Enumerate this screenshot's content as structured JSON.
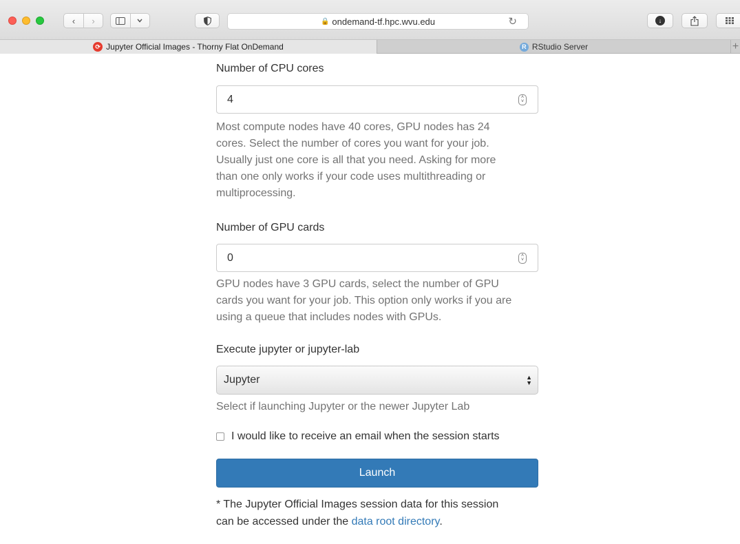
{
  "browser": {
    "url": "ondemand-tf.hpc.wvu.edu",
    "nav_back": "‹",
    "nav_forward": "›",
    "tabs": [
      {
        "title": "Jupyter Official Images - Thorny Flat OnDemand",
        "active": true,
        "favicon": "jupyter-icon"
      },
      {
        "title": "RStudio Server",
        "active": false,
        "favicon": "r-icon"
      }
    ],
    "new_tab_label": "+"
  },
  "form": {
    "cpu": {
      "label": "Number of CPU cores",
      "value": "4",
      "help_lines": [
        "Most compute nodes have 40 cores, GPU nodes has 24",
        "cores. Select the number of cores you want for your job.",
        "Usually just one core is all that you need. Asking for more",
        "than one only works if your code uses multithreading or",
        "multiprocessing."
      ]
    },
    "gpu": {
      "label": "Number of GPU cards",
      "value": "0",
      "help_lines": [
        "GPU nodes have 3 GPU cards, select the number of GPU",
        "cards you want for your job. This option only works if you are",
        "using a queue that includes nodes with GPUs."
      ]
    },
    "mode": {
      "label": "Execute jupyter or jupyter-lab",
      "selected": "Jupyter",
      "help": "Select if launching Jupyter or the newer Jupyter Lab"
    },
    "email_checkbox": {
      "label": "I would like to receive an email when the session starts",
      "checked": false
    },
    "launch_label": "Launch",
    "note": {
      "line1": "* The Jupyter Official Images session data for this session",
      "line2_prefix": "can be accessed under the ",
      "link_text": "data root directory",
      "line2_suffix": "."
    }
  },
  "colors": {
    "primary": "#337ab7",
    "help_text": "#737373",
    "link": "#337ab7"
  }
}
